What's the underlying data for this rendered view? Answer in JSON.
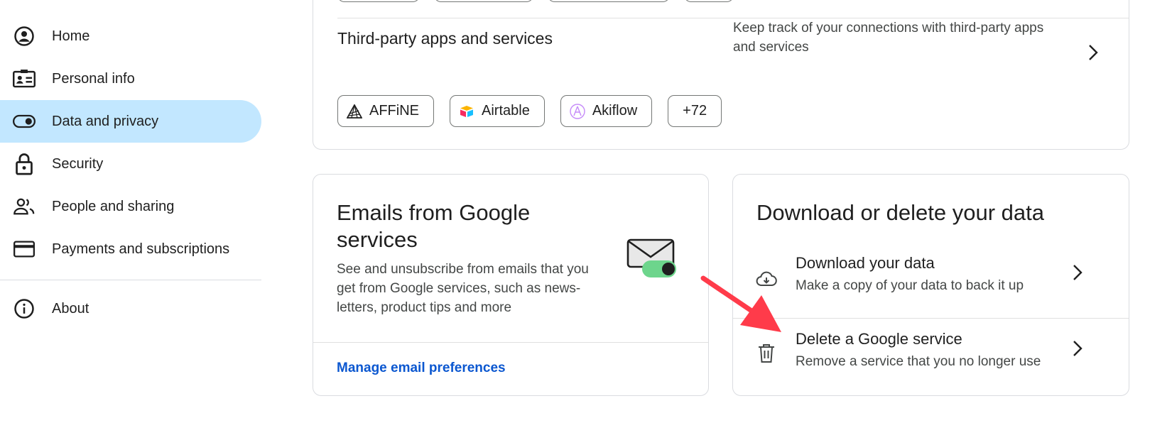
{
  "sidebar": {
    "items": [
      {
        "label": "Home",
        "icon": "account-circle-icon",
        "active": false
      },
      {
        "label": "Personal info",
        "icon": "id-card-icon",
        "active": false
      },
      {
        "label": "Data and privacy",
        "icon": "toggle-icon",
        "active": true
      },
      {
        "label": "Security",
        "icon": "lock-icon",
        "active": false
      },
      {
        "label": "People and sharing",
        "icon": "people-icon",
        "active": false
      },
      {
        "label": "Payments and subscriptions",
        "icon": "credit-card-icon",
        "active": false
      },
      {
        "label": "About",
        "icon": "info-icon",
        "active": false
      }
    ]
  },
  "third_party": {
    "title": "Third-party apps and services",
    "description": "Keep track of your connections with third-party apps and services",
    "chips": [
      {
        "label": "AFFiNE",
        "icon": "affine-logo-icon"
      },
      {
        "label": "Airtable",
        "icon": "airtable-logo-icon"
      },
      {
        "label": "Akiflow",
        "icon": "akiflow-logo-icon"
      },
      {
        "label": "+72"
      }
    ]
  },
  "emails": {
    "title": "Emails from Google services",
    "description": "See and unsubscribe from emails that you get from Google services, such as news-letters, product tips and more",
    "link": "Manage email preferences"
  },
  "download_delete": {
    "title": "Download or delete your data",
    "rows": [
      {
        "title": "Download your data",
        "subtitle": "Make a copy of your data to back it up",
        "icon": "cloud-download-icon"
      },
      {
        "title": "Delete a Google service",
        "subtitle": "Remove a service that you no longer use",
        "icon": "trash-icon"
      }
    ]
  },
  "colors": {
    "active_nav": "#c2e7ff",
    "link": "#0b57d0",
    "toggle_on": "#6dd58c",
    "annotation_arrow": "#ff3b4a"
  }
}
